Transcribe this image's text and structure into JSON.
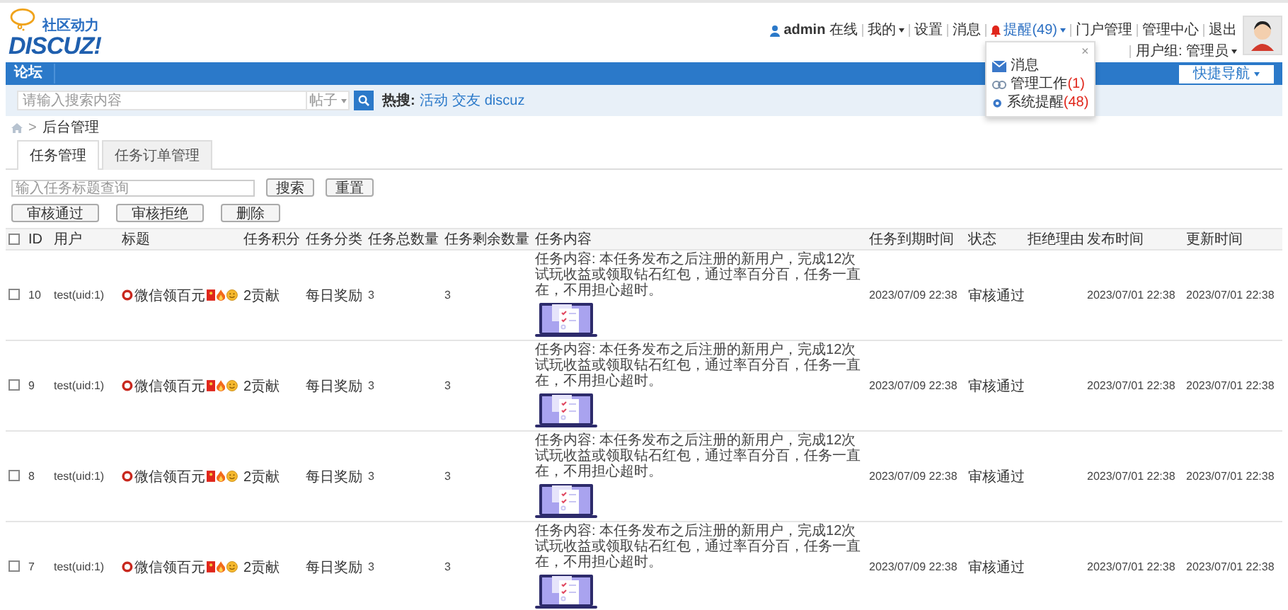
{
  "logo": {
    "tagline": "社区动力",
    "wordmark": "DISCUZ!"
  },
  "user_bar": {
    "username": "admin",
    "status": "在线",
    "links": [
      {
        "label": "我的",
        "dropdown": true,
        "kind": "plain"
      },
      {
        "label": "设置",
        "dropdown": false,
        "kind": "plain"
      },
      {
        "label": "消息",
        "dropdown": false,
        "kind": "plain"
      },
      {
        "label": "提醒(49)",
        "dropdown": true,
        "kind": "notice"
      },
      {
        "label": "门户管理",
        "dropdown": false,
        "kind": "plain"
      },
      {
        "label": "管理中心",
        "dropdown": false,
        "kind": "plain"
      },
      {
        "label": "退出",
        "dropdown": false,
        "kind": "plain"
      }
    ],
    "user_group": "用户组: 管理员"
  },
  "notice_menu": {
    "close": "×",
    "items": [
      {
        "label": "消息",
        "kind": "message"
      },
      {
        "label": "管理工作",
        "count": "(1)",
        "kind": "work"
      },
      {
        "label": "系统提醒",
        "count": "(48)",
        "kind": "system"
      }
    ]
  },
  "nav": {
    "items": [
      {
        "label": "论坛",
        "selected": true
      }
    ],
    "quick_nav": "快捷导航"
  },
  "search": {
    "placeholder": "请输入搜索内容",
    "scope": "帖子",
    "hot_label": "热搜:",
    "hot": [
      "活动",
      "交友",
      "discuz"
    ]
  },
  "breadcrumb": {
    "separator": ">",
    "current": "后台管理"
  },
  "tabs": [
    {
      "label": "任务管理",
      "selected": true
    },
    {
      "label": "任务订单管理",
      "selected": false
    }
  ],
  "filter": {
    "placeholder": "输入任务标题查询",
    "buttons": [
      "搜索",
      "重置"
    ]
  },
  "actions": [
    "审核通过",
    "审核拒绝",
    "删除"
  ],
  "table": {
    "columns": [
      "ID",
      "用户",
      "标题",
      "任务积分",
      "任务分类",
      "任务总数量",
      "任务剩余数量",
      "任务内容",
      "任务到期时间",
      "状态",
      "拒绝理由",
      "发布时间",
      "更新时间"
    ],
    "select_all": false,
    "rows": [
      {
        "checked": false,
        "id": "10",
        "user": "test(uid:1)",
        "title": "微信领百元",
        "points": "2贡献",
        "category": "每日奖励",
        "total": "3",
        "remaining": "3",
        "content": "任务内容: 本任务发布之后注册的新用户，完成12次试玩收益或领取钻石红包，通过率百分百，任务一直在，不用担心超时。",
        "deadline": "2023/07/09 22:38",
        "status": "审核通过",
        "published": "2023/07/01 22:38",
        "updated": "2023/07/01 22:38"
      },
      {
        "checked": false,
        "id": "9",
        "user": "test(uid:1)",
        "title": "微信领百元",
        "points": "2贡献",
        "category": "每日奖励",
        "total": "3",
        "remaining": "3",
        "content": "任务内容: 本任务发布之后注册的新用户，完成12次试玩收益或领取钻石红包，通过率百分百，任务一直在，不用担心超时。",
        "deadline": "2023/07/09 22:38",
        "status": "审核通过",
        "published": "2023/07/01 22:38",
        "updated": "2023/07/01 22:38"
      },
      {
        "checked": false,
        "id": "8",
        "user": "test(uid:1)",
        "title": "微信领百元",
        "points": "2贡献",
        "category": "每日奖励",
        "total": "3",
        "remaining": "3",
        "content": "任务内容: 本任务发布之后注册的新用户，完成12次试玩收益或领取钻石红包，通过率百分百，任务一直在，不用担心超时。",
        "deadline": "2023/07/09 22:38",
        "status": "审核通过",
        "published": "2023/07/01 22:38",
        "updated": "2023/07/01 22:38"
      },
      {
        "checked": false,
        "id": "7",
        "user": "test(uid:1)",
        "title": "微信领百元",
        "points": "2贡献",
        "category": "每日奖励",
        "total": "3",
        "remaining": "3",
        "content": "任务内容: 本任务发布之后注册的新用户，完成12次试玩收益或领取钻石红包，通过率百分百，任务一直在，不用担心超时。",
        "deadline": "2023/07/09 22:38",
        "status": "审核通过",
        "published": "2023/07/01 22:38",
        "updated": "2023/07/01 22:38"
      }
    ]
  }
}
